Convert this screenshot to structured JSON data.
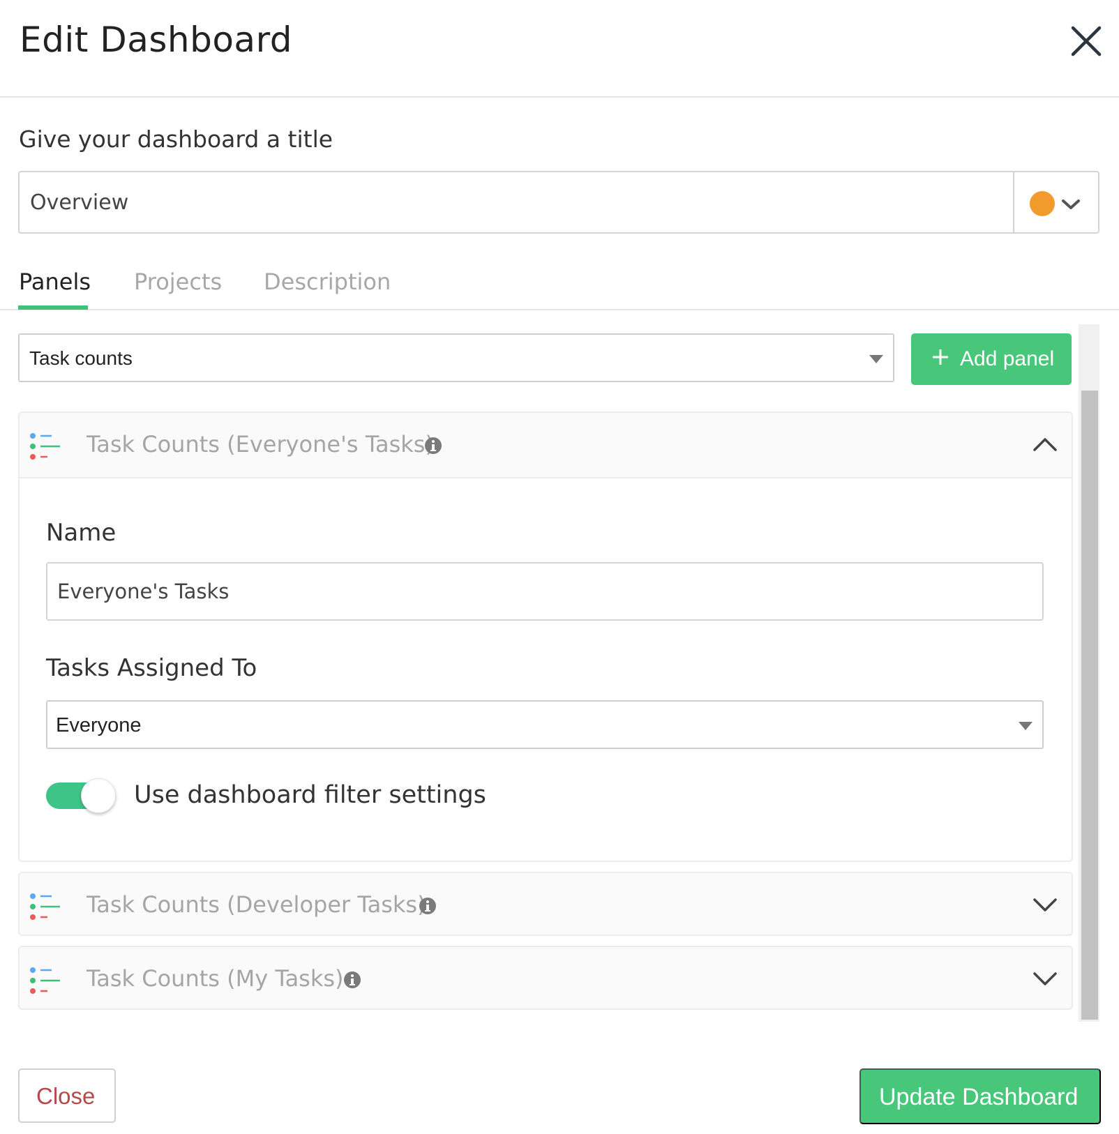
{
  "modal": {
    "title": "Edit Dashboard",
    "close_icon": "close-icon"
  },
  "dashboard_title": {
    "label": "Give your dashboard a title",
    "value": "Overview",
    "color": "#f19b2c"
  },
  "tabs": [
    {
      "label": "Panels",
      "active": true
    },
    {
      "label": "Projects",
      "active": false
    },
    {
      "label": "Description",
      "active": false
    }
  ],
  "panel_type_select": {
    "value": "Task counts"
  },
  "add_panel_button": {
    "label": "Add panel",
    "icon": "plus-icon"
  },
  "panels": [
    {
      "title": "Task Counts (Everyone's Tasks)",
      "expanded": true,
      "fields": {
        "name_label": "Name",
        "name_value": "Everyone's Tasks",
        "assigned_label": "Tasks Assigned To",
        "assigned_value": "Everyone",
        "toggle_label": "Use dashboard filter settings",
        "toggle_on": true
      }
    },
    {
      "title": "Task Counts (Developer Tasks)",
      "expanded": false
    },
    {
      "title": "Task Counts (My Tasks)",
      "expanded": false
    }
  ],
  "footer": {
    "close_label": "Close",
    "update_label": "Update Dashboard"
  },
  "colors": {
    "accent_green": "#48c77a",
    "toggle_green": "#3fc488",
    "close_text": "#b54a4a"
  }
}
